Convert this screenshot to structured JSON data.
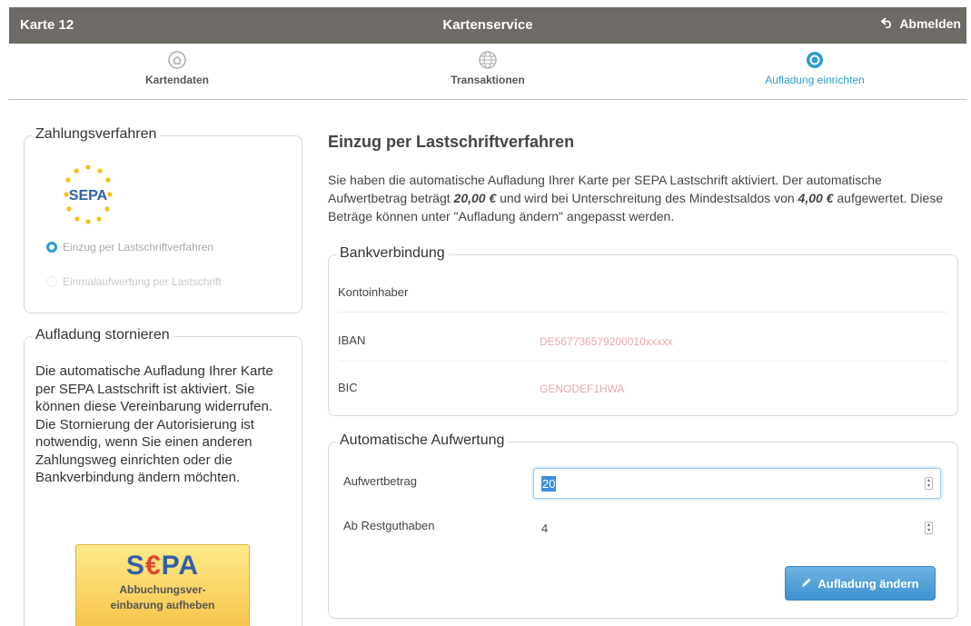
{
  "topbar": {
    "card": "Karte 12",
    "title": "Kartenservice",
    "logout": "Abmelden"
  },
  "nav": {
    "tabs": [
      {
        "label": "Kartendaten",
        "icon": "home-icon"
      },
      {
        "label": "Transaktionen",
        "icon": "globe-icon"
      },
      {
        "label": "Aufladung einrichten",
        "icon": "settings-circle-icon",
        "active": true
      }
    ]
  },
  "payment": {
    "legend": "Zahlungsverfahren",
    "logo_text": "SEPA",
    "options": [
      {
        "label": "Einzug per Lastschriftverfahren",
        "selected": true
      },
      {
        "label": "Einmalaufwertung per Lastschrift",
        "selected": false
      }
    ]
  },
  "cancel": {
    "legend": "Aufladung stornieren",
    "text": "Die automatische Aufladung Ihrer Karte per SEPA Lastschrift ist aktiviert. Sie können diese Vereinbarung widerrufen.",
    "text2": "Die Stornierung der Autorisierung ist notwendig, wenn Sie einen anderen Zahlungsweg einrichten oder die Bankverbindung ändern möchten.",
    "button_big": "S€PA",
    "button_line1": "Abbuchungsver-",
    "button_line2": "einbarung aufheben"
  },
  "main": {
    "heading": "Einzug per Lastschriftverfahren",
    "info_1": "Sie haben die automatische Aufladung Ihrer Karte per SEPA Lastschrift aktiviert. Der automatische Aufwertbetrag beträgt ",
    "info_amount": "20,00 €",
    "info_2": " und wird bei Unterschreitung des Mindestsaldos von ",
    "info_min": "4,00 €",
    "info_3": " aufgewertet. Diese Beträge können unter \"Aufladung ändern\" angepasst werden."
  },
  "bank": {
    "legend": "Bankverbindung",
    "owner_label": "Kontoinhaber",
    "owner_value": "",
    "iban_label": "IBAN",
    "iban_value": "DE567736579200010xxxxx",
    "bic_label": "BIC",
    "bic_value": "GENODEF1HWA"
  },
  "auto": {
    "legend": "Automatische Aufwertung",
    "amount_label": "Aufwertbetrag",
    "amount_value": "20",
    "rest_label": "Ab Restguthaben",
    "rest_value": "4",
    "change_button": "Aufladung ändern"
  },
  "colors": {
    "accent": "#2c9bd6",
    "topbar": "#6e6a66",
    "sepa_blue": "#2f5fa8",
    "sepa_yellow": "#f6c54c"
  }
}
